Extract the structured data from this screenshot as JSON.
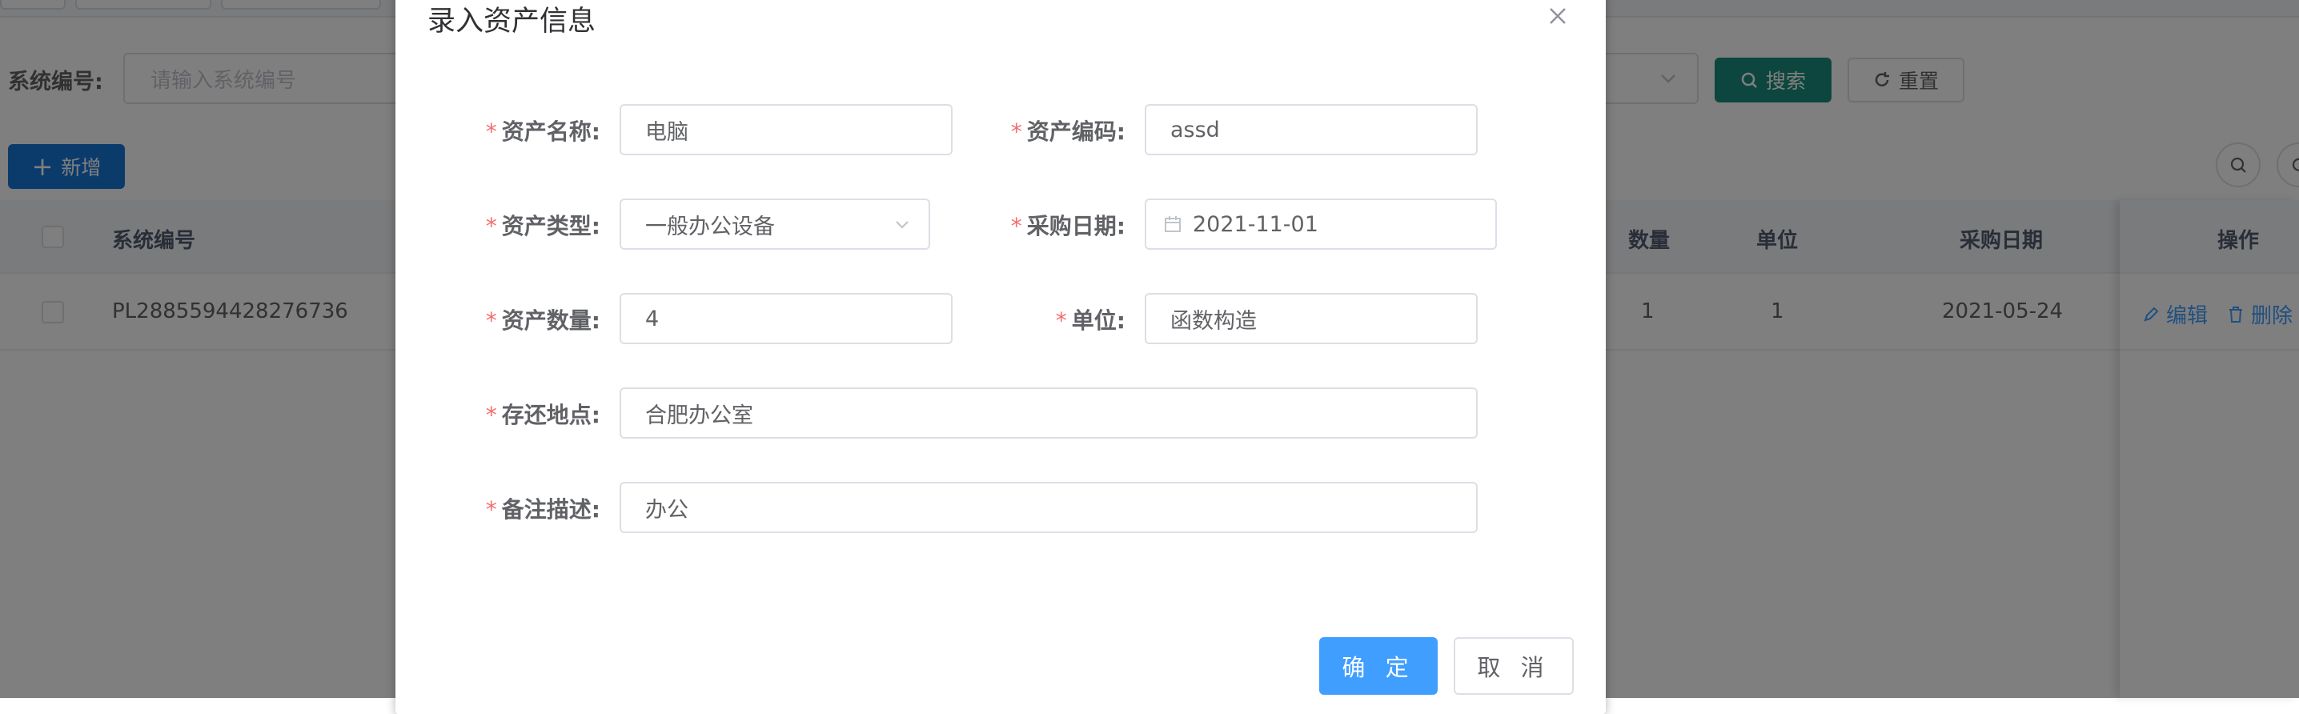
{
  "colors": {
    "primary": "#409eff",
    "search_button": "#1a8c7c",
    "add_button": "#1677d6",
    "required": "#f56c6c",
    "overlay": "rgba(0,0,0,0.5)"
  },
  "filter": {
    "system_no_label": "系统编号:",
    "system_no_placeholder": "请输入系统编号",
    "search_label": "搜索",
    "reset_label": "重置"
  },
  "toolbar": {
    "add_label": "新增"
  },
  "table": {
    "headers": {
      "system_no": "系统编号",
      "quantity": "数量",
      "unit": "单位",
      "purchase_date": "采购日期",
      "actions": "操作"
    },
    "rows": [
      {
        "system_no": "PL2885594428276736",
        "quantity": "1",
        "unit": "1",
        "purchase_date": "2021-05-24",
        "edit_label": "编辑",
        "delete_label": "删除"
      }
    ]
  },
  "dialog": {
    "title": "录入资产信息",
    "fields": {
      "asset_name": {
        "label": "资产名称:",
        "value": "电脑"
      },
      "asset_code": {
        "label": "资产编码:",
        "value": "assd"
      },
      "asset_type": {
        "label": "资产类型:",
        "value": "一般办公设备"
      },
      "purchase_date": {
        "label": "采购日期:",
        "value": "2021-11-01"
      },
      "asset_quantity": {
        "label": "资产数量:",
        "value": "4"
      },
      "unit": {
        "label": "单位:",
        "value": "函数构造"
      },
      "location": {
        "label": "存还地点:",
        "value": "合肥办公室"
      },
      "remarks": {
        "label": "备注描述:",
        "value": "办公"
      }
    },
    "required_mark": "*",
    "confirm_label": "确 定",
    "cancel_label": "取 消"
  },
  "icons": [
    "close-icon",
    "search-icon",
    "refresh-icon",
    "plus-icon",
    "chevron-down-icon",
    "calendar-icon",
    "edit-icon",
    "delete-icon"
  ]
}
